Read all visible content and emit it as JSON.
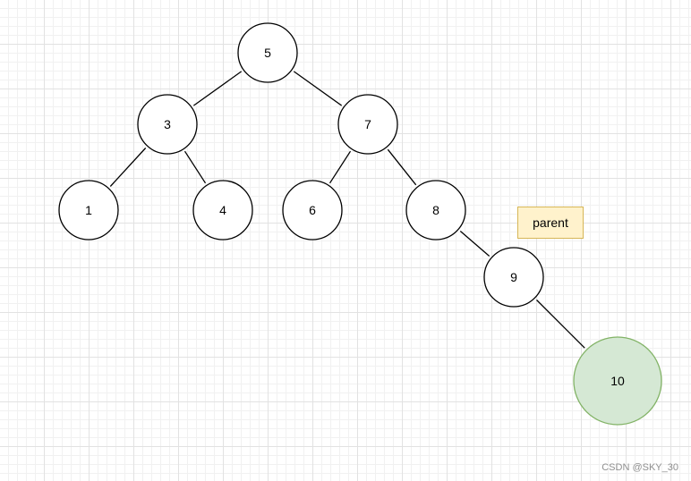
{
  "nodes": [
    {
      "id": "n5",
      "label": "5"
    },
    {
      "id": "n3",
      "label": "3"
    },
    {
      "id": "n7",
      "label": "7"
    },
    {
      "id": "n1",
      "label": "1"
    },
    {
      "id": "n4",
      "label": "4"
    },
    {
      "id": "n6",
      "label": "6"
    },
    {
      "id": "n8",
      "label": "8"
    },
    {
      "id": "n9",
      "label": "9"
    },
    {
      "id": "n10",
      "label": "10",
      "fill": "#d5e8d4",
      "stroke": "#82b366"
    }
  ],
  "edges": [
    {
      "from": "n5",
      "to": "n3"
    },
    {
      "from": "n5",
      "to": "n7"
    },
    {
      "from": "n3",
      "to": "n1"
    },
    {
      "from": "n3",
      "to": "n4"
    },
    {
      "from": "n7",
      "to": "n6"
    },
    {
      "from": "n7",
      "to": "n8"
    },
    {
      "from": "n8",
      "to": "n9"
    },
    {
      "from": "n9",
      "to": "n10"
    }
  ],
  "annotation": {
    "text": "parent",
    "fill": "#fff2cc",
    "stroke": "#d6b656"
  },
  "watermark": "CSDN @SKY_30",
  "colors": {
    "default_node_fill": "#ffffff",
    "default_node_stroke": "#000000"
  }
}
